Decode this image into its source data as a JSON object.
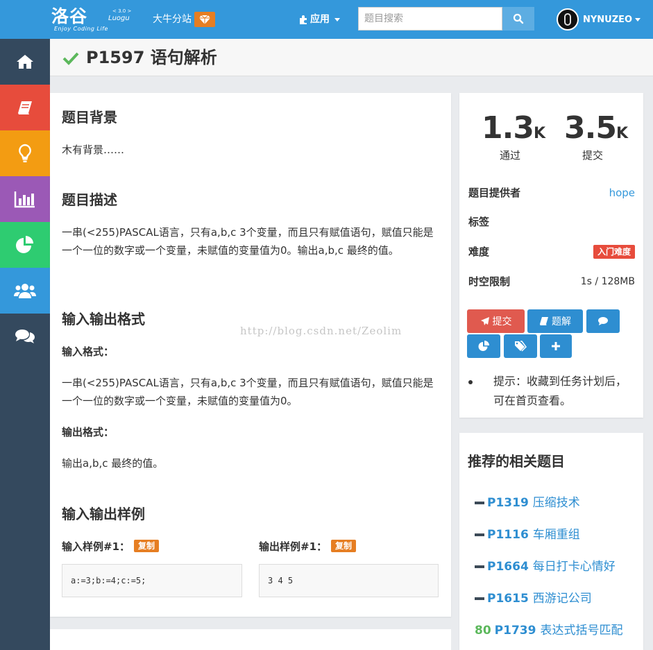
{
  "header": {
    "logo_main": "洛谷",
    "logo_sub": "Enjoy Coding Life",
    "logo_ver": "< 3.0 >",
    "logo_en": "Luogu",
    "subsite_label": "大牛分站",
    "apps_label": "应用",
    "search_placeholder": "题目搜索",
    "username": "NYNUZEO"
  },
  "problem": {
    "title": "P1597 语句解析",
    "background_title": "题目背景",
    "background_text": "木有背景……",
    "description_title": "题目描述",
    "description_text": "一串(<255)PASCAL语言，只有a,b,c 3个变量，而且只有赋值语句，赋值只能是一个一位的数字或一个变量，未赋值的变量值为0。输出a,b,c 最终的值。",
    "io_title": "输入输出格式",
    "input_format_label": "输入格式：",
    "input_format_text": "一串(<255)PASCAL语言，只有a,b,c 3个变量，而且只有赋值语句，赋值只能是一个一位的数字或一个变量，未赋值的变量值为0。",
    "output_format_label": "输出格式：",
    "output_format_text": "输出a,b,c 最终的值。",
    "samples_title": "输入输出样例",
    "sample_input_label": "输入样例#1：",
    "sample_output_label": "输出样例#1：",
    "copy_label": "复制",
    "sample_input": "a:=3;b:=4;c:=5;",
    "sample_output": "3 4 5",
    "watermark": "http://blog.csdn.net/Zeolim"
  },
  "stats": {
    "accepted_value": "1.3",
    "accepted_unit": "K",
    "accepted_label": "通过",
    "submitted_value": "3.5",
    "submitted_unit": "K",
    "submitted_label": "提交"
  },
  "info": {
    "provider_label": "题目提供者",
    "provider_value": "hope",
    "tags_label": "标签",
    "difficulty_label": "难度",
    "difficulty_value": "入门难度",
    "limit_label": "时空限制",
    "limit_value": "1s / 128MB"
  },
  "actions": {
    "submit_label": "提交",
    "solution_label": "题解"
  },
  "hint": "提示：收藏到任务计划后，可在首页查看。",
  "recommend": {
    "title": "推荐的相关题目",
    "items": [
      {
        "score": "",
        "pid": "P1319",
        "name": "压缩技术"
      },
      {
        "score": "",
        "pid": "P1116",
        "name": "车厢重组"
      },
      {
        "score": "",
        "pid": "P1664",
        "name": "每日打卡心情好"
      },
      {
        "score": "",
        "pid": "P1615",
        "name": "西游记公司"
      },
      {
        "score": "80",
        "pid": "P1739",
        "name": "表达式括号匹配"
      }
    ]
  },
  "colors": {
    "brand": "#3498db",
    "sidebar": "#34495e",
    "accent_orange": "#e67e22",
    "danger": "#e74c3c",
    "success": "#5cb85c"
  }
}
